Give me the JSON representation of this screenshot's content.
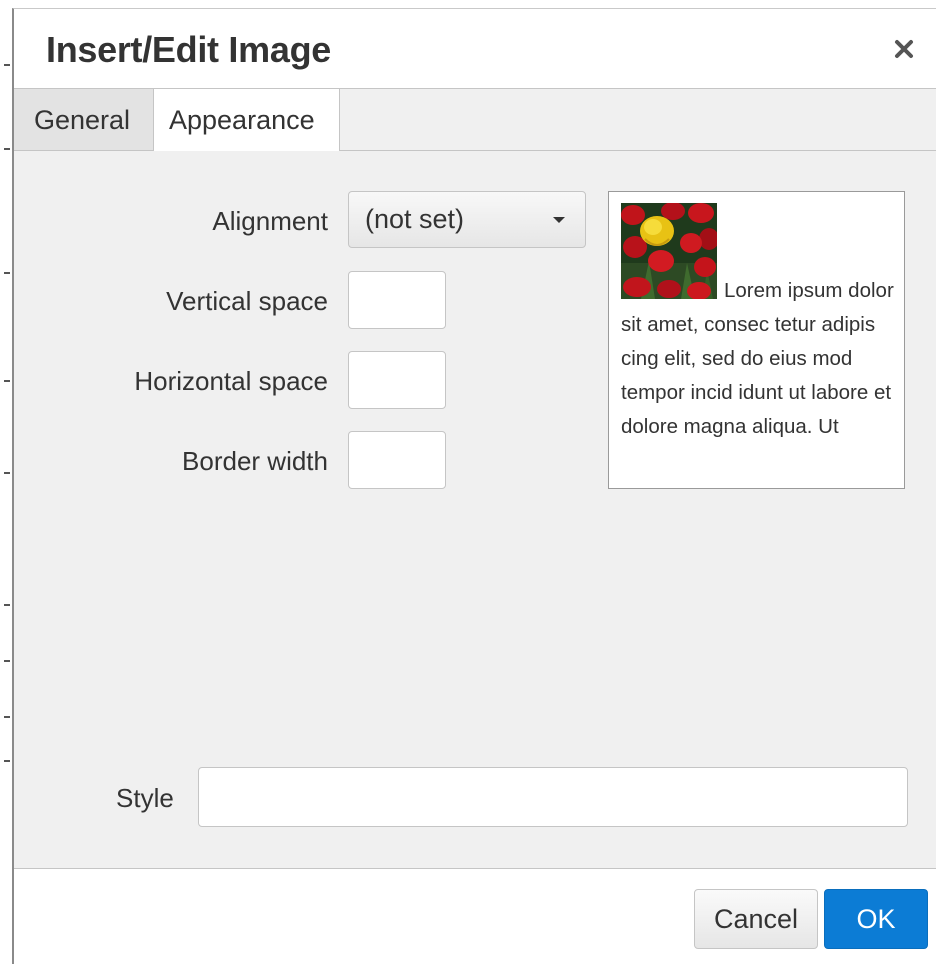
{
  "dialog": {
    "title": "Insert/Edit Image",
    "close_icon": "close-icon"
  },
  "tabs": [
    {
      "label": "General",
      "active": false
    },
    {
      "label": "Appearance",
      "active": true
    }
  ],
  "appearance": {
    "alignment": {
      "label": "Alignment",
      "value": "(not set)"
    },
    "vertical_space": {
      "label": "Vertical space",
      "value": ""
    },
    "horizontal_space": {
      "label": "Horizontal space",
      "value": ""
    },
    "border_width": {
      "label": "Border width",
      "value": ""
    },
    "preview_text": "Lorem ipsum dolor sit amet, consec tetur adipis cing elit, sed do eius mod tempor incid idunt ut labore et dolore magna aliqua. Ut",
    "style": {
      "label": "Style",
      "value": ""
    }
  },
  "footer": {
    "cancel_label": "Cancel",
    "ok_label": "OK"
  },
  "colors": {
    "accent": "#0c7cd5",
    "panel": "#f0f0f0"
  }
}
